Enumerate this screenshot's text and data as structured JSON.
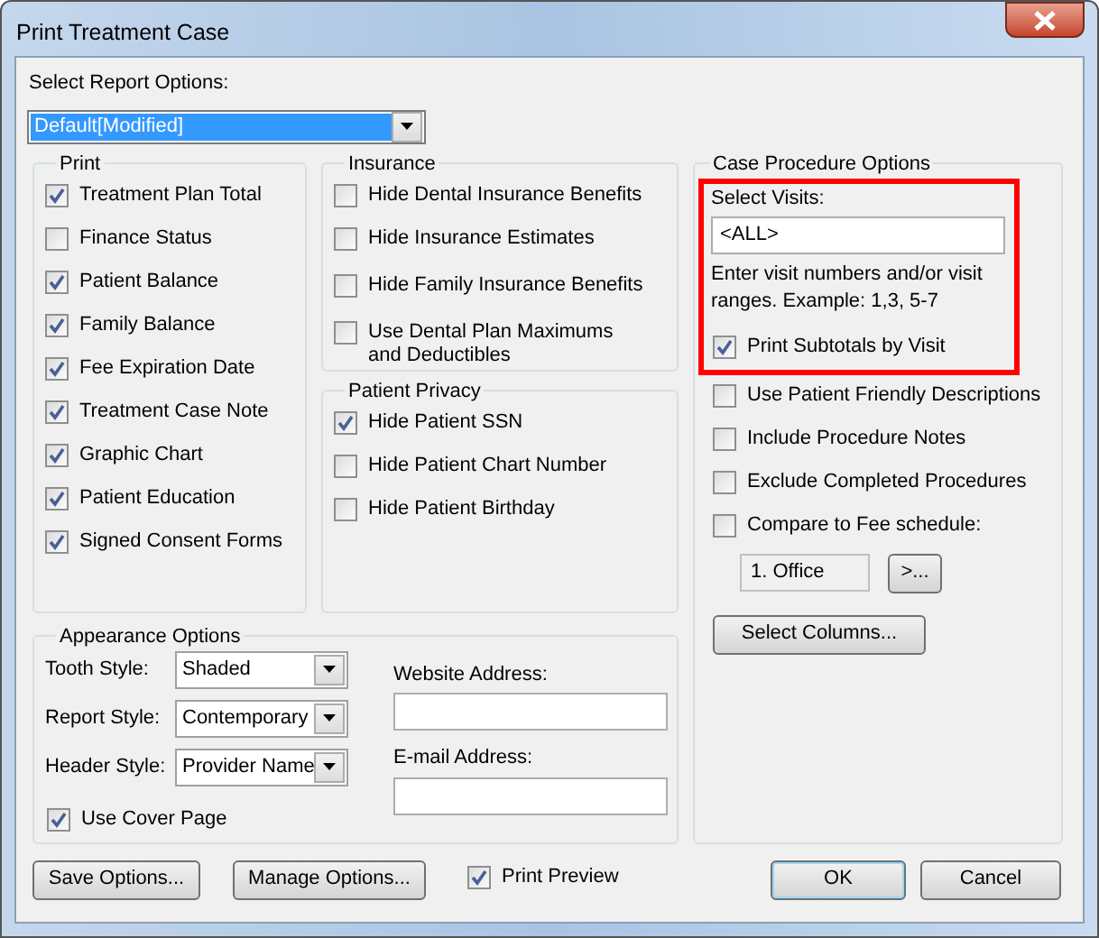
{
  "window": {
    "title": "Print Treatment Case"
  },
  "report_options": {
    "label": "Select Report Options:",
    "value": "Default[Modified]"
  },
  "print_group": {
    "title": "Print",
    "items": [
      {
        "label": "Treatment Plan Total",
        "checked": true
      },
      {
        "label": "Finance Status",
        "checked": false
      },
      {
        "label": "Patient Balance",
        "checked": true
      },
      {
        "label": "Family Balance",
        "checked": true
      },
      {
        "label": "Fee Expiration Date",
        "checked": true
      },
      {
        "label": "Treatment Case Note",
        "checked": true
      },
      {
        "label": "Graphic Chart",
        "checked": true
      },
      {
        "label": "Patient Education",
        "checked": true
      },
      {
        "label": "Signed Consent Forms",
        "checked": true
      }
    ]
  },
  "insurance": {
    "title": "Insurance",
    "items": [
      {
        "label": "Hide Dental Insurance Benefits",
        "checked": false
      },
      {
        "label": "Hide Insurance Estimates",
        "checked": false
      },
      {
        "label": "Hide Family Insurance Benefits",
        "checked": false
      },
      {
        "label": "Use Dental Plan Maximums and Deductibles",
        "checked": false
      }
    ]
  },
  "patient_privacy": {
    "title": "Patient Privacy",
    "items": [
      {
        "label": "Hide Patient SSN",
        "checked": true
      },
      {
        "label": "Hide Patient Chart Number",
        "checked": false
      },
      {
        "label": "Hide Patient Birthday",
        "checked": false
      }
    ]
  },
  "case_procedure_options": {
    "title": "Case Procedure Options",
    "select_visits": {
      "label": "Select Visits:",
      "value": "<ALL>"
    },
    "hint": "Enter visit numbers and/or visit ranges. Example: 1,3, 5-7",
    "subtotals": {
      "label": "Print Subtotals by Visit",
      "checked": true
    },
    "items": [
      {
        "label": "Use Patient Friendly Descriptions",
        "checked": false
      },
      {
        "label": "Include Procedure Notes",
        "checked": false
      },
      {
        "label": "Exclude Completed Procedures",
        "checked": false
      },
      {
        "label": "Compare to Fee schedule:",
        "checked": false
      }
    ],
    "fee_schedule": {
      "value": "1.  Office",
      "button": ">..."
    },
    "select_columns": "Select Columns..."
  },
  "appearance": {
    "title": "Appearance Options",
    "dropdowns": [
      {
        "label": "Tooth Style:",
        "value": "Shaded"
      },
      {
        "label": "Report Style:",
        "value": "Contemporary"
      },
      {
        "label": "Header Style:",
        "value": "Provider Name"
      }
    ],
    "fields": [
      {
        "label": "Website Address:"
      },
      {
        "label": "E-mail Address:"
      }
    ],
    "cover_page": {
      "label": "Use Cover Page",
      "checked": true
    }
  },
  "footer": {
    "save": "Save Options...",
    "manage": "Manage Options...",
    "print_preview": {
      "label": "Print Preview",
      "checked": true
    },
    "ok": "OK",
    "cancel": "Cancel"
  }
}
